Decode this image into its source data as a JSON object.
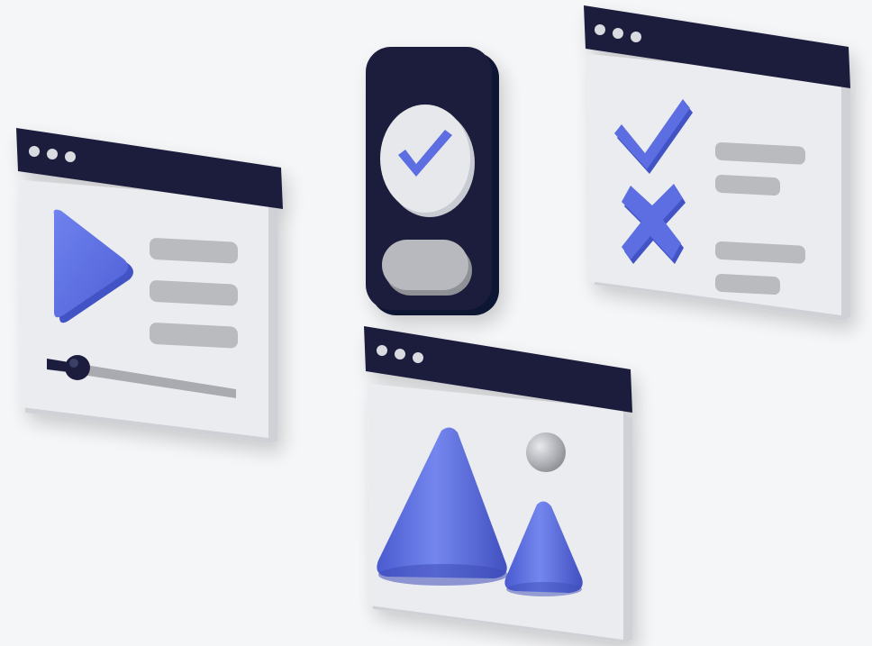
{
  "scene": {
    "title": "",
    "colors": {
      "background": "#f5f6f8",
      "panel_face": "#eaebee",
      "panel_side": "#cfd1d6",
      "titlebar": "#1c1f3d",
      "accent": "#5b6ee1",
      "accent_dark": "#4657c4",
      "placeholder_bar": "#b9bbbf",
      "dot": "#d9dbe0"
    }
  },
  "media_player_window": {
    "icons": [
      "play-icon",
      "slider-icon"
    ],
    "text_line_count": 3,
    "slider_level": 0.1
  },
  "phone_card": {
    "icons": [
      "checkmark-icon"
    ],
    "button_label": ""
  },
  "checklist_window": {
    "icons": [
      "checkmark-icon",
      "cross-icon"
    ],
    "rows": 2
  },
  "image_window": {
    "icons": [
      "mountain-icon",
      "sun-icon"
    ]
  }
}
